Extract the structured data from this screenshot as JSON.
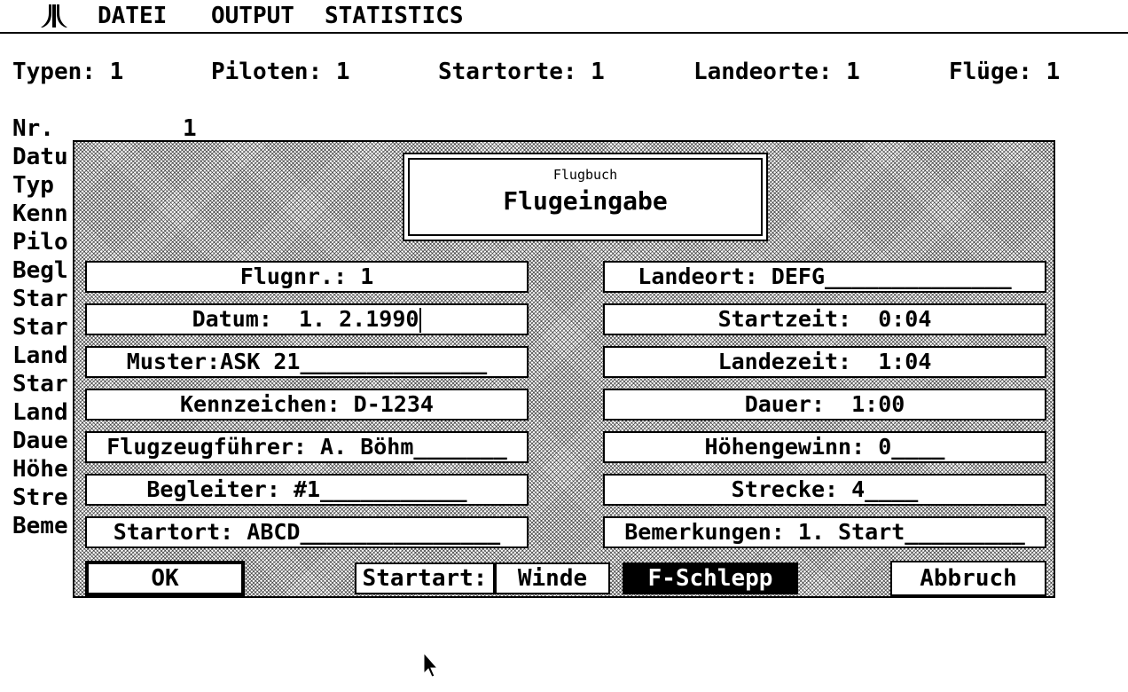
{
  "menu": {
    "items": [
      "DATEI",
      "OUTPUT",
      "STATISTICS"
    ]
  },
  "counts": {
    "typen": "Typen: 1",
    "piloten": "Piloten: 1",
    "startorte": "Startorte: 1",
    "landeorte": "Landeorte: 1",
    "fluege": "Flüge: 1"
  },
  "record": {
    "nr_label": "Nr.",
    "nr_value": "1",
    "labels_visible": [
      "Datu",
      "Typ",
      "Kenn",
      "Pilo",
      "Begl",
      "Star",
      "Star",
      "Land",
      "Star",
      "Land",
      "Daue",
      "Höhe",
      "Stre",
      "Beme"
    ]
  },
  "dialog": {
    "subtitle": "Flugbuch",
    "title": "Flugeingabe",
    "left_fields": [
      "Flugnr.: 1",
      "Datum:  1. 2.1990",
      "Muster:ASK 21______________",
      "Kennzeichen: D-1234",
      "Flugzeugführer: A. Böhm_______",
      "Begleiter: #1___________",
      "Startort: ABCD_______________"
    ],
    "right_fields": [
      "Landeort: DEFG______________",
      "Startzeit:  0:04",
      "Landezeit:  1:04",
      "Dauer:  1:00",
      "Höhengewinn: 0____",
      "Strecke: 4____",
      "Bemerkungen: 1. Start_________"
    ],
    "ok_label": "OK",
    "startart_label": "Startart:",
    "startart_options": [
      "Winde",
      "F-Schlepp"
    ],
    "startart_selected": "F-Schlepp",
    "abort_label": "Abbruch"
  }
}
